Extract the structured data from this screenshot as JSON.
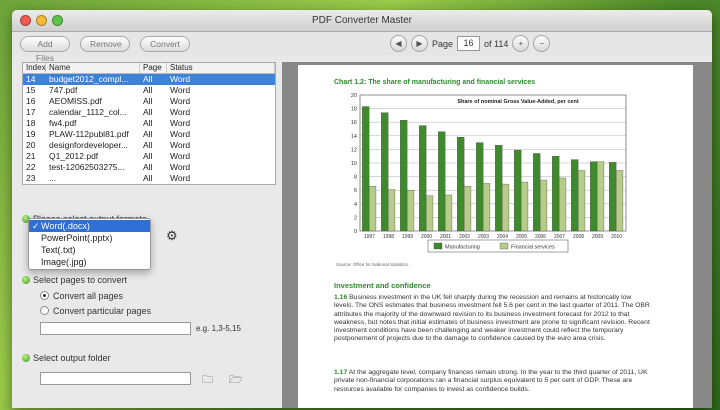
{
  "window": {
    "title": "PDF Converter Master"
  },
  "toolbar": {
    "add_files": "Add Files",
    "remove": "Remove",
    "convert": "Convert"
  },
  "pager": {
    "page_label": "Page",
    "current_page": "16",
    "total": "of 114"
  },
  "table": {
    "headers": [
      "Index",
      "Name",
      "Page",
      "Status"
    ],
    "rows": [
      [
        "14",
        "budget2012_compl...",
        "All",
        "Word"
      ],
      [
        "15",
        "747.pdf",
        "All",
        "Word"
      ],
      [
        "16",
        "AEOMISS.pdf",
        "All",
        "Word"
      ],
      [
        "17",
        "calendar_1112_col...",
        "All",
        "Word"
      ],
      [
        "18",
        "fw4.pdf",
        "All",
        "Word"
      ],
      [
        "19",
        "PLAW-112publ81.pdf",
        "All",
        "Word"
      ],
      [
        "20",
        "designfordeveloper...",
        "All",
        "Word"
      ],
      [
        "21",
        "Q1_2012.pdf",
        "All",
        "Word"
      ],
      [
        "22",
        "test-12062503275...",
        "All",
        "Word"
      ],
      [
        "23",
        "...",
        "All",
        "Word"
      ]
    ]
  },
  "formats": {
    "label": "Please select output formats",
    "options": [
      "Word(.docx)",
      "PowerPoint(.pptx)",
      "Text(.txt)",
      "Image(.jpg)"
    ],
    "selected_mark": "✓"
  },
  "pages": {
    "label": "Select pages to convert",
    "all": "Convert all pages",
    "particular": "Convert particular pages",
    "hint": "e.g. 1,3-5,15"
  },
  "output": {
    "label": "Select output folder"
  },
  "icons": {
    "settings": "gear-icon",
    "browse": "folder-search-icon",
    "open": "folder-icon"
  },
  "document": {
    "chart_title": "Chart 1.2: The share of manufacturing and financial services",
    "source": "Source: Office for National Statistics.",
    "heading": "Investment and confidence",
    "para1_num": "1.16",
    "para1": "Business investment in the UK fell sharply during the recession and remains at historically low levels. The ONS estimates that business investment fell 5.6 per cent in the last quarter of 2011. The OBR attributes the majority of the downward revision to its business investment forecast for 2012 to that weakness, but notes that initial estimates of business investment are prone to significant revision. Recent investment conditions have been challenging and weaker investment could reflect the temporary postponement of projects due to the damage to confidence caused by the euro area crisis.",
    "para2_num": "1.17",
    "para2": "At the aggregate level, company finances remain strong. In the year to the third quarter of 2011, UK private non-financial corporations ran a financial surplus equivalent to 5 per cent of GDP. These are resources available for companies to invest as confidence builds."
  },
  "chart_data": {
    "type": "bar",
    "title": "Chart 1.2: The share of manufacturing and financial services",
    "subtitle": "Share of nominal Gross Value-Added, per cent",
    "categories": [
      "1997",
      "1998",
      "1999",
      "2000",
      "2001",
      "2002",
      "2003",
      "2004",
      "2005",
      "2006",
      "2007",
      "2008",
      "2009",
      "2010"
    ],
    "series": [
      {
        "name": "Manufacturing",
        "color": "#3e8a2c",
        "values": [
          18.3,
          17.4,
          16.3,
          15.5,
          14.6,
          13.8,
          13.0,
          12.6,
          11.9,
          11.4,
          11.0,
          10.5,
          10.2,
          10.1
        ]
      },
      {
        "name": "Financial services",
        "color": "#b7cc8a",
        "values": [
          6.6,
          6.1,
          6.0,
          5.2,
          5.3,
          6.6,
          7.0,
          6.9,
          7.2,
          7.5,
          7.8,
          8.9,
          10.2,
          8.9
        ]
      }
    ],
    "ylim": [
      0,
      20
    ],
    "yticks": [
      0,
      2,
      4,
      6,
      8,
      10,
      12,
      14,
      16,
      18,
      20
    ],
    "grid": true,
    "legend": "bottom"
  }
}
